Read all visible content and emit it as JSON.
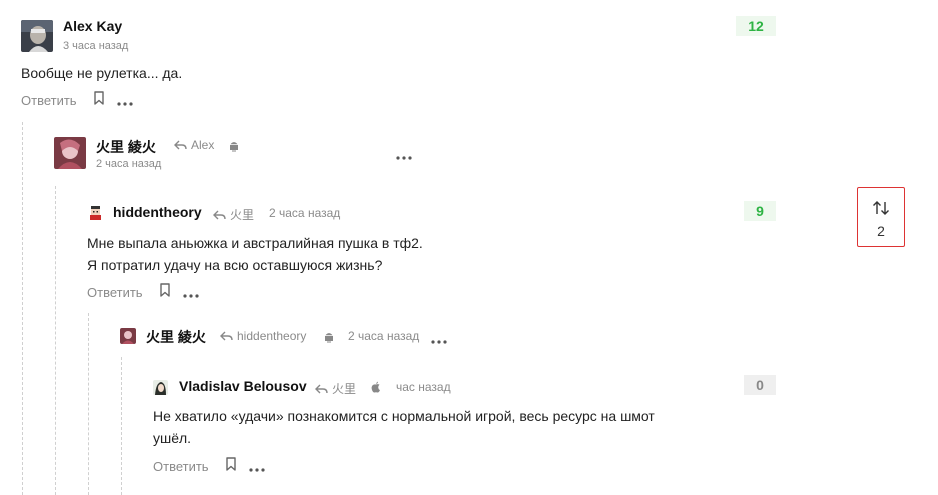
{
  "comments": {
    "c1": {
      "author": "Alex Kay",
      "time": "3 часа назад",
      "text": "Вообще не рулетка... да.",
      "score": "12",
      "reply_label": "Ответить"
    },
    "c2": {
      "author": "火里 綾火",
      "reply_to": "Alex",
      "time": "2 часа назад"
    },
    "c3": {
      "author": "hiddentheory",
      "reply_to": "火里",
      "time": "2 часа назад",
      "text_line1": "Мне выпала аньюжка и австралийная пушка в тф2.",
      "text_line2": "Я потратил удачу на всю оставшуюся жизнь?",
      "score": "9",
      "reply_label": "Ответить"
    },
    "c4": {
      "author": "火里 綾火",
      "reply_to": "hiddentheory",
      "time": "2 часа назад"
    },
    "c5": {
      "author": "Vladislav Belousov",
      "reply_to": "火里",
      "time": "час назад",
      "text_line1": "Не хватило «удачи» познакомится с нормальной игрой, весь ресурс на шмот",
      "text_line2": "ушёл.",
      "score": "0",
      "reply_label": "Ответить"
    }
  },
  "sort_widget": {
    "value": "2",
    "icon": "sort-arrows-icon"
  },
  "icons": {
    "reply_arrow": "reply-arrow-icon",
    "bookmark": "bookmark-icon",
    "more": "more-dots-icon",
    "android": "android-icon",
    "apple": "apple-icon"
  },
  "colors": {
    "positive_score_text": "#2eb344",
    "positive_score_bg": "#eef8ee",
    "zero_score_text": "#888888",
    "zero_score_bg": "#efefef",
    "sort_border": "#dd3333"
  }
}
